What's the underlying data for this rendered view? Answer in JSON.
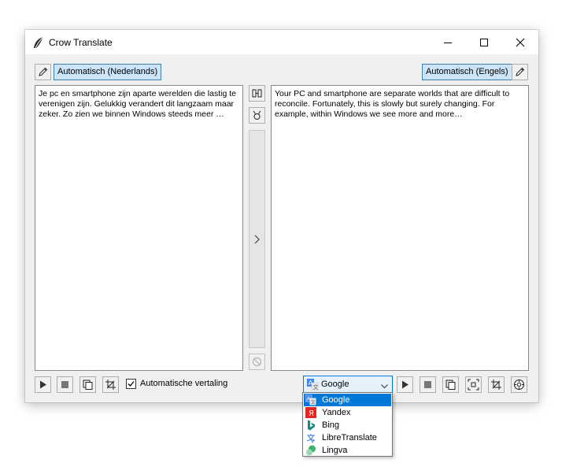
{
  "window": {
    "title": "Crow Translate"
  },
  "source": {
    "language_button": "Automatisch (Nederlands)",
    "text": "Je pc en smartphone zijn aparte werelden die lastig te verenigen zijn. Gelukkig verandert dit langzaam maar zeker. Zo zien we binnen Windows steeds meer …"
  },
  "translation": {
    "language_button": "Automatisch (Engels)",
    "text": "Your PC and smartphone are separate worlds that are difficult to reconcile. Fortunately, this is slowly but surely changing. For example, within Windows we see more and more…"
  },
  "options": {
    "auto_translate_label": "Automatische vertaling",
    "auto_translate_checked": true
  },
  "engine": {
    "selected": "Google",
    "options": [
      "Google",
      "Yandex",
      "Bing",
      "LibreTranslate",
      "Lingva"
    ]
  },
  "colors": {
    "accent": "#0078d7",
    "language_button_bg": "#cce4f7",
    "window_bg": "#f0f0f0"
  },
  "icons": {
    "app": "crow-icon",
    "swap": "swap-languages-icon",
    "copy_all": "copy-all-icon",
    "translate": "chevron-right-icon",
    "abort": "abort-icon",
    "edit": "pencil-icon"
  }
}
